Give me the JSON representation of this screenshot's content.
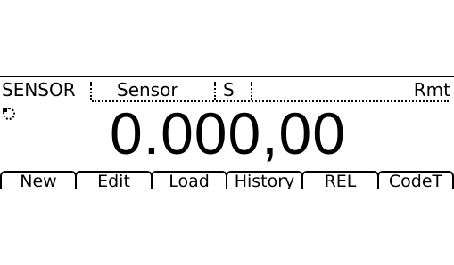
{
  "status": {
    "sensor_label": "SENSOR",
    "sensor_value": "Sensor",
    "unit": "S",
    "remote": "Rmt"
  },
  "reading": {
    "value": "0.000,00"
  },
  "softkeys": [
    {
      "label": "New"
    },
    {
      "label": "Edit"
    },
    {
      "label": "Load"
    },
    {
      "label": "History"
    },
    {
      "label": "REL"
    },
    {
      "label": "CodeT"
    }
  ],
  "icons": {
    "busy": "busy-indicator-icon"
  }
}
